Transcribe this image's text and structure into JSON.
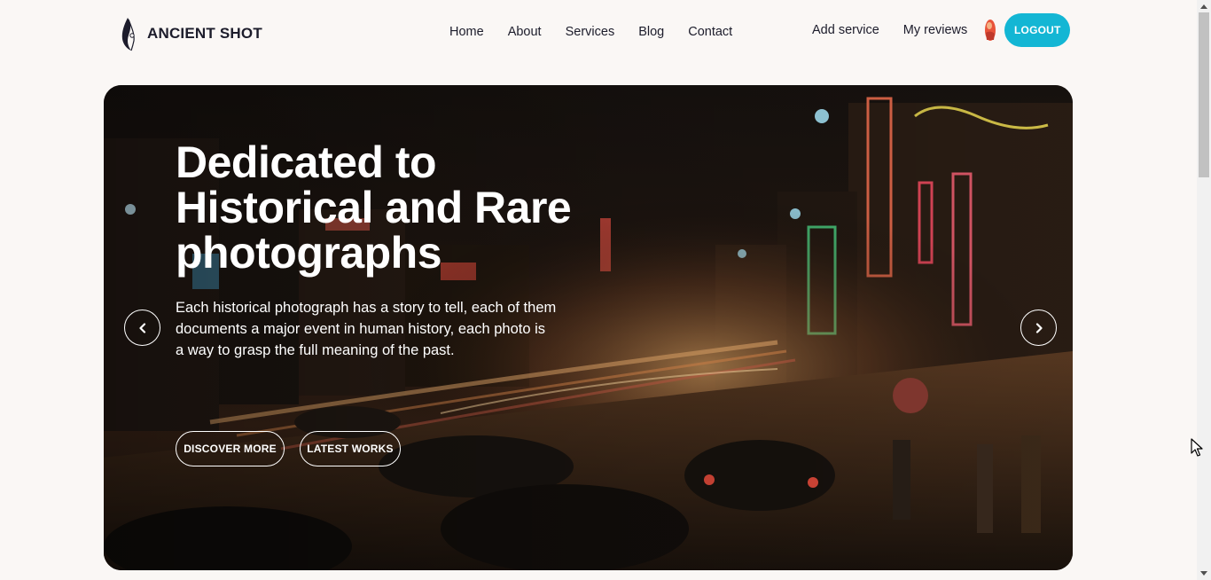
{
  "brand": {
    "name": "ANCIENT SHOT",
    "logo_icon": "feather-logo-icon"
  },
  "nav": {
    "items": [
      {
        "label": "Home"
      },
      {
        "label": "About"
      },
      {
        "label": "Services"
      },
      {
        "label": "Blog"
      },
      {
        "label": "Contact"
      }
    ]
  },
  "user_nav": {
    "add_service": "Add service",
    "my_reviews": "My reviews",
    "avatar_icon": "user-avatar-icon",
    "logout_label": "LOGOUT"
  },
  "hero": {
    "title": "Dedicated to Historical and Rare photographs",
    "text": "Each historical photograph has a story to tell, each of them documents a major event in human history, each photo is a way to grasp the full meaning of the past.",
    "discover_label": "DISCOVER MORE",
    "latest_label": "LATEST WORKS",
    "prev_icon": "chevron-left-icon",
    "next_icon": "chevron-right-icon",
    "background": "vintage night street photograph with neon signs and cars"
  },
  "colors": {
    "accent": "#13b6d4",
    "page_background": "#faf7f5",
    "text_dark": "#1c1c2b"
  }
}
